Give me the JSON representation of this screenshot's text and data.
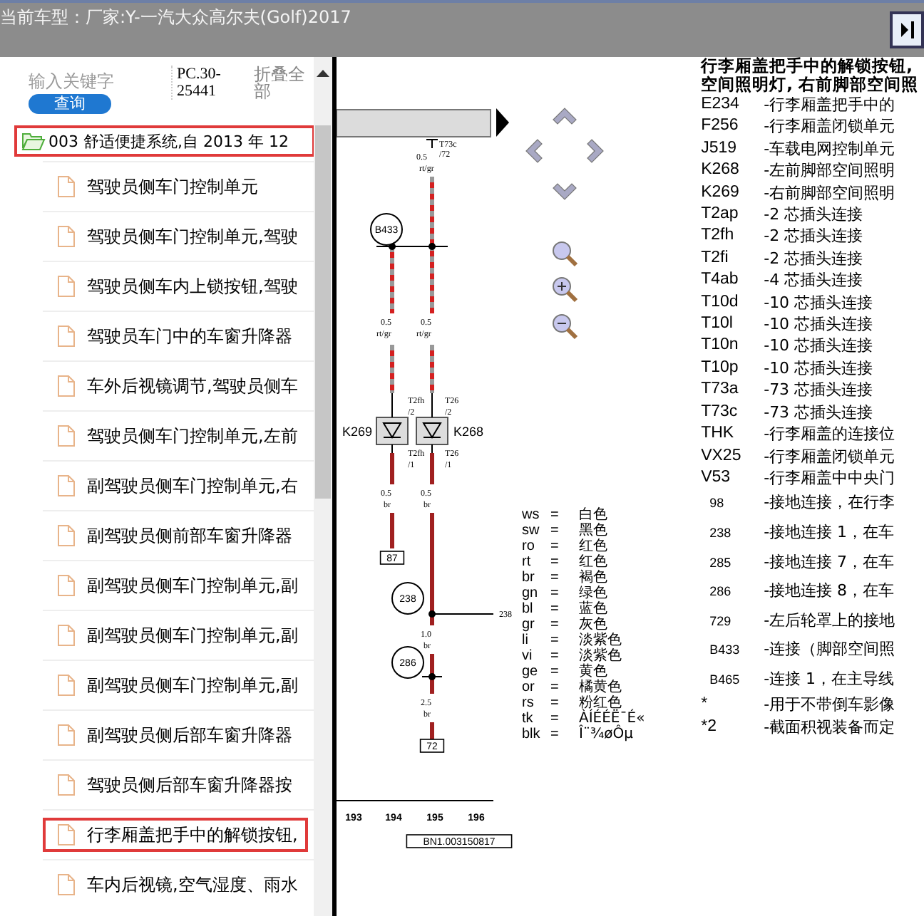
{
  "header": {
    "title": "当前车型：厂家:Y-一汽大众高尔夫(Golf)2017"
  },
  "search": {
    "placeholder": "输入关键字",
    "button": "查询",
    "code": "PC.30-25441",
    "collapse": "折叠全部"
  },
  "tree": [
    {
      "label": "003 舒适便捷系统,自 2013 年 12",
      "expanded": true,
      "highlighted": true,
      "children": [
        {
          "label": "驾驶员侧车门控制单元",
          "highlighted": false
        },
        {
          "label": "驾驶员侧车门控制单元,驾驶",
          "highlighted": false
        },
        {
          "label": "驾驶员侧车内上锁按钮,驾驶",
          "highlighted": false
        },
        {
          "label": "驾驶员车门中的车窗升降器",
          "highlighted": false
        },
        {
          "label": "车外后视镜调节,驾驶员侧车",
          "highlighted": false
        },
        {
          "label": "驾驶员侧车门控制单元,左前",
          "highlighted": false
        },
        {
          "label": "副驾驶员侧车门控制单元,右",
          "highlighted": false
        },
        {
          "label": "副驾驶员侧前部车窗升降器",
          "highlighted": false
        },
        {
          "label": "副驾驶员侧车门控制单元,副",
          "highlighted": false
        },
        {
          "label": "副驾驶员侧车门控制单元,副",
          "highlighted": false
        },
        {
          "label": "副驾驶员侧车门控制单元,副",
          "highlighted": false
        },
        {
          "label": "副驾驶员侧后部车窗升降器",
          "highlighted": false
        },
        {
          "label": "驾驶员侧后部车窗升降器按",
          "highlighted": false
        },
        {
          "label": "行李厢盖把手中的解锁按钮,",
          "highlighted": true
        },
        {
          "label": "车内后视镜,空气湿度、雨水",
          "highlighted": false
        }
      ]
    }
  ],
  "diagram": {
    "texts": [
      {
        "text": "T73c",
        "kind": "label"
      },
      {
        "text": "/72",
        "kind": "label"
      },
      {
        "text": "0.5",
        "kind": "label"
      },
      {
        "text": "rt/gr",
        "kind": "label"
      },
      {
        "text": "B433",
        "kind": "circle"
      },
      {
        "text": "0.5",
        "kind": "label"
      },
      {
        "text": "rt/gr",
        "kind": "label"
      },
      {
        "text": "0.5",
        "kind": "label"
      },
      {
        "text": "rt/gr",
        "kind": "label"
      },
      {
        "text": "T2fh",
        "kind": "label"
      },
      {
        "text": "/2",
        "kind": "label"
      },
      {
        "text": "T26",
        "kind": "label"
      },
      {
        "text": "/2",
        "kind": "label"
      },
      {
        "text": "K269",
        "kind": "name"
      },
      {
        "text": "K268",
        "kind": "name"
      },
      {
        "text": "T2fh",
        "kind": "label"
      },
      {
        "text": "/1",
        "kind": "label"
      },
      {
        "text": "T26",
        "kind": "label"
      },
      {
        "text": "/1",
        "kind": "label"
      },
      {
        "text": "0.5",
        "kind": "label"
      },
      {
        "text": "br",
        "kind": "label"
      },
      {
        "text": "0.5",
        "kind": "label"
      },
      {
        "text": "br",
        "kind": "label"
      },
      {
        "text": "87",
        "kind": "box"
      },
      {
        "text": "238",
        "kind": "circle"
      },
      {
        "text": "238",
        "kind": "label"
      },
      {
        "text": "1.0",
        "kind": "label"
      },
      {
        "text": "br",
        "kind": "label"
      },
      {
        "text": "286",
        "kind": "circle"
      },
      {
        "text": "2.5",
        "kind": "label"
      },
      {
        "text": "br",
        "kind": "label"
      },
      {
        "text": "72",
        "kind": "box"
      },
      {
        "text": "193",
        "kind": "tick"
      },
      {
        "text": "194",
        "kind": "tick"
      },
      {
        "text": "195",
        "kind": "tick"
      },
      {
        "text": "196",
        "kind": "tick"
      },
      {
        "text": "BN1.003150817",
        "kind": "box"
      }
    ],
    "legend": [
      {
        "code": "ws",
        "sign": "=",
        "name": "白色"
      },
      {
        "code": "sw",
        "sign": "=",
        "name": "黑色"
      },
      {
        "code": "ro",
        "sign": "=",
        "name": "红色"
      },
      {
        "code": "rt",
        "sign": "=",
        "name": "红色"
      },
      {
        "code": "br",
        "sign": "=",
        "name": "褐色"
      },
      {
        "code": "gn",
        "sign": "=",
        "name": "绿色"
      },
      {
        "code": "bl",
        "sign": "=",
        "name": "蓝色"
      },
      {
        "code": "gr",
        "sign": "=",
        "name": "灰色"
      },
      {
        "code": "li",
        "sign": "=",
        "name": "淡紫色"
      },
      {
        "code": "vi",
        "sign": "=",
        "name": "淡紫色"
      },
      {
        "code": "ge",
        "sign": "=",
        "name": "黄色"
      },
      {
        "code": "or",
        "sign": "=",
        "name": "橘黄色"
      },
      {
        "code": "rs",
        "sign": "=",
        "name": "粉红色"
      },
      {
        "code": "tk",
        "sign": "=",
        "name": "ÀÍÉÉË¯É«"
      },
      {
        "code": "blk",
        "sign": "=",
        "name": "Î¨¾øÔµ"
      }
    ]
  },
  "parts": {
    "title": [
      "行李厢盖把手中的解锁按钮,",
      "空间照明灯, 右前脚部空间照"
    ],
    "items": [
      {
        "code": "E234",
        "desc": "-行李厢盖把手中的",
        "kind": "part"
      },
      {
        "code": "F256",
        "desc": "-行李厢盖闭锁单元",
        "kind": "part"
      },
      {
        "code": "J519",
        "desc": "-车载电网控制单元",
        "kind": "part"
      },
      {
        "code": "K268",
        "desc": "-左前脚部空间照明",
        "kind": "part"
      },
      {
        "code": "K269",
        "desc": "-右前脚部空间照明",
        "kind": "part"
      },
      {
        "code": "T2ap",
        "desc": "-2 芯插头连接",
        "kind": "part"
      },
      {
        "code": "T2fh",
        "desc": "-2 芯插头连接",
        "kind": "part"
      },
      {
        "code": "T2fi",
        "desc": "-2 芯插头连接",
        "kind": "part"
      },
      {
        "code": "T4ab",
        "desc": "-4 芯插头连接",
        "kind": "part"
      },
      {
        "code": "T10d",
        "desc": "-10 芯插头连接",
        "kind": "part"
      },
      {
        "code": "T10l",
        "desc": "-10 芯插头连接",
        "kind": "part"
      },
      {
        "code": "T10n",
        "desc": "-10 芯插头连接",
        "kind": "part"
      },
      {
        "code": "T10p",
        "desc": "-10 芯插头连接",
        "kind": "part"
      },
      {
        "code": "T73a",
        "desc": "-73 芯插头连接",
        "kind": "part"
      },
      {
        "code": "T73c",
        "desc": "-73 芯插头连接",
        "kind": "part"
      },
      {
        "code": "THK",
        "desc": "-行李厢盖的连接位",
        "kind": "part"
      },
      {
        "code": "VX25",
        "desc": "-行李厢盖闭锁单元",
        "kind": "part"
      },
      {
        "code": "V53",
        "desc": "-行李厢盖中中央门",
        "kind": "part"
      },
      {
        "code": "98",
        "desc": "-接地连接，在行李",
        "kind": "ground"
      },
      {
        "code": "238",
        "desc": "-接地连接 1，在车",
        "kind": "ground"
      },
      {
        "code": "285",
        "desc": "-接地连接 7，在车",
        "kind": "ground"
      },
      {
        "code": "286",
        "desc": "-接地连接 8，在车",
        "kind": "ground"
      },
      {
        "code": "729",
        "desc": "-左后轮罩上的接地",
        "kind": "ground"
      },
      {
        "code": "B433",
        "desc": "-连接（脚部空间照",
        "kind": "ground"
      },
      {
        "code": "B465",
        "desc": "-连接 1，在主导线",
        "kind": "ground"
      },
      {
        "code": "*",
        "desc": "-用于不带倒车影像",
        "kind": "part"
      },
      {
        "code": "*2",
        "desc": "-截面积视装备而定",
        "kind": "part"
      }
    ]
  }
}
